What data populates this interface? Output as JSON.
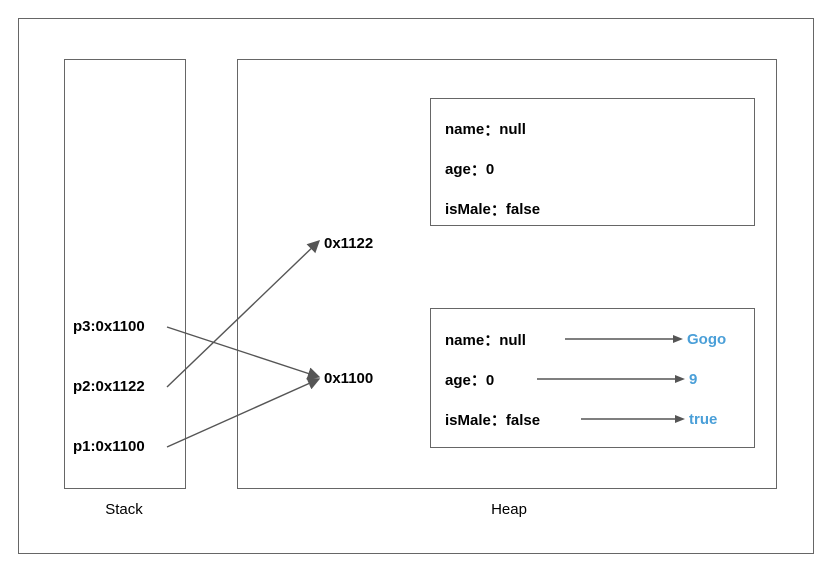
{
  "labels": {
    "stack": "Stack",
    "heap": "Heap"
  },
  "stack": {
    "items": [
      {
        "name": "p3",
        "addr": "0x1100"
      },
      {
        "name": "p2",
        "addr": "0x1122"
      },
      {
        "name": "p1",
        "addr": "0x1100"
      }
    ]
  },
  "heap": {
    "addresses": {
      "a": "0x1122",
      "b": "0x1100"
    },
    "objects": [
      {
        "fields": [
          {
            "label": "name",
            "value": "null"
          },
          {
            "label": "age",
            "value": "0"
          },
          {
            "label": "isMale",
            "value": "false"
          }
        ]
      },
      {
        "fields": [
          {
            "label": "name",
            "value": "null",
            "new": "Gogo"
          },
          {
            "label": "age",
            "value": "0",
            "new": "9"
          },
          {
            "label": "isMale",
            "value": "false",
            "new": "true"
          }
        ]
      }
    ]
  },
  "colors": {
    "border": "#666666",
    "accent": "#4a9fd8"
  }
}
